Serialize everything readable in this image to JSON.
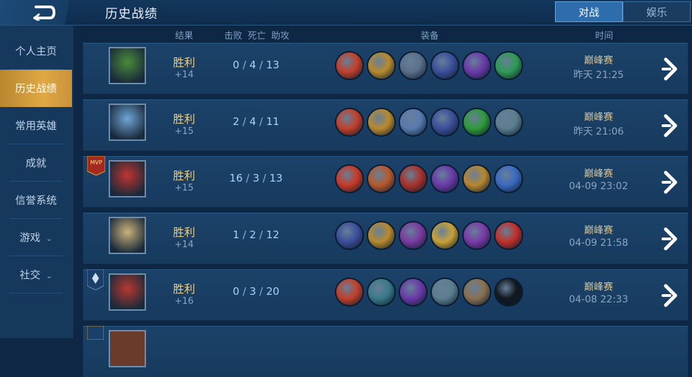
{
  "header": {
    "title": "历史战绩",
    "tabs": [
      {
        "label": "对战",
        "active": true
      },
      {
        "label": "娱乐",
        "active": false
      }
    ]
  },
  "sidebar": {
    "items": [
      {
        "label": "个人主页",
        "active": false
      },
      {
        "label": "历史战绩",
        "active": true
      },
      {
        "label": "常用英雄",
        "active": false
      },
      {
        "label": "成就",
        "active": false
      },
      {
        "label": "信誉系统",
        "active": false
      },
      {
        "label": "游戏",
        "active": false,
        "expandable": true
      },
      {
        "label": "社交",
        "active": false,
        "expandable": true
      }
    ]
  },
  "columns": {
    "result": "结果",
    "kills": "击败",
    "deaths": "死亡",
    "assists": "助攻",
    "equipment": "装备",
    "time": "时间"
  },
  "matches": [
    {
      "result": "胜利",
      "points": "+14",
      "kills": "0",
      "deaths": "4",
      "assists": "13",
      "mode": "巅峰赛",
      "time": "昨天 21:25",
      "badge": "",
      "hero_color": "#4a8a3a"
    },
    {
      "result": "胜利",
      "points": "+15",
      "kills": "2",
      "deaths": "4",
      "assists": "11",
      "mode": "巅峰赛",
      "time": "昨天 21:06",
      "badge": "",
      "hero_color": "#6fa6d8"
    },
    {
      "result": "胜利",
      "points": "+15",
      "kills": "16",
      "deaths": "3",
      "assists": "13",
      "mode": "巅峰赛",
      "time": "04-09 23:02",
      "badge": "MVP",
      "hero_color": "#c0342f"
    },
    {
      "result": "胜利",
      "points": "+14",
      "kills": "1",
      "deaths": "2",
      "assists": "12",
      "mode": "巅峰赛",
      "time": "04-09 21:58",
      "badge": "",
      "hero_color": "#cbb27a"
    },
    {
      "result": "胜利",
      "points": "+16",
      "kills": "0",
      "deaths": "3",
      "assists": "20",
      "mode": "巅峰赛",
      "time": "04-08 22:33",
      "badge": "rank",
      "hero_color": "#b8382e"
    }
  ],
  "colors": {
    "accent": "#2e6dab",
    "active_side": "#e0a844",
    "win_text": "#f2cf7a"
  },
  "icons": [
    "back-arrow-icon",
    "chevron-right-icon",
    "chevron-down-icon",
    "mvp-badge-icon",
    "rank-badge-icon"
  ]
}
